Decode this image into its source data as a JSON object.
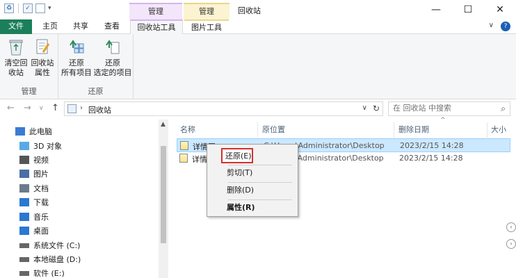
{
  "window": {
    "title": "回收站",
    "context_group_1": "管理",
    "context_group_2": "管理",
    "controls": {
      "minimize": "—",
      "maximize": "☐",
      "close": "✕"
    }
  },
  "quick_access": {
    "dropdown": "▾"
  },
  "ribbon_tabs": [
    {
      "label": "文件",
      "type": "file"
    },
    {
      "label": "主页"
    },
    {
      "label": "共享"
    },
    {
      "label": "查看"
    },
    {
      "label": "回收站工具",
      "active": true
    },
    {
      "label": "图片工具"
    }
  ],
  "ribbon_right": {
    "collapse": "∨",
    "help": "?"
  },
  "ribbon": {
    "groups": [
      {
        "label": "管理",
        "buttons": [
          {
            "line1": "清空回",
            "line2": "收站",
            "icon": "empty-recycle-bin-icon"
          },
          {
            "line1": "回收站",
            "line2": "属性",
            "icon": "recycle-bin-properties-icon"
          }
        ]
      },
      {
        "label": "还原",
        "buttons": [
          {
            "line1": "还原",
            "line2": "所有项目",
            "icon": "restore-all-icon"
          },
          {
            "line1": "还原",
            "line2": "选定的项目",
            "icon": "restore-selected-icon"
          }
        ]
      }
    ]
  },
  "nav": {
    "back": "←",
    "forward": "→",
    "recent": "∨",
    "up": "↑",
    "breadcrumb_sep": "›",
    "path": "回收站",
    "dropdown": "∨",
    "refresh": "↻"
  },
  "search": {
    "placeholder": "在 回收站 中搜索",
    "icon": "⌕"
  },
  "navpane": {
    "items": [
      {
        "label": "此电脑",
        "icon": "computer-icon",
        "color": "#3a7bd5"
      },
      {
        "label": "3D 对象",
        "icon": "3d-objects-icon",
        "color": "#5aa9e6"
      },
      {
        "label": "视频",
        "icon": "videos-icon",
        "color": "#555555"
      },
      {
        "label": "图片",
        "icon": "pictures-icon",
        "color": "#4a6fa5"
      },
      {
        "label": "文档",
        "icon": "documents-icon",
        "color": "#6b7b8c"
      },
      {
        "label": "下载",
        "icon": "downloads-icon",
        "color": "#2b78d0"
      },
      {
        "label": "音乐",
        "icon": "music-icon",
        "color": "#2b78d0"
      },
      {
        "label": "桌面",
        "icon": "desktop-icon",
        "color": "#2b78d0"
      },
      {
        "label": "系统文件 (C:)",
        "icon": "drive-c-icon",
        "color": "#666666"
      },
      {
        "label": "本地磁盘 (D:)",
        "icon": "drive-d-icon",
        "color": "#666666"
      },
      {
        "label": "软件 (E:)",
        "icon": "drive-e-icon",
        "color": "#666666"
      }
    ]
  },
  "filelist": {
    "columns": [
      "名称",
      "原位置",
      "删除日期",
      "大小"
    ],
    "sort_indicator": "^",
    "rows": [
      {
        "name": "详情图_5 (1)",
        "location": "C:\\Users\\Administrator\\Desktop",
        "date": "2023/2/15 14:28",
        "selected": true
      },
      {
        "name": "详情",
        "location": "C:\\Users\\Administrator\\Desktop",
        "date": "2023/2/15 14:28",
        "selected": false
      }
    ]
  },
  "context_menu": {
    "items": [
      "还原(E)",
      "剪切(T)",
      "删除(D)",
      "属性(R)"
    ]
  },
  "colors": {
    "file_tab": "#1a7f5a",
    "selection": "#cce8ff",
    "highlight_border": "#d32f2f"
  }
}
